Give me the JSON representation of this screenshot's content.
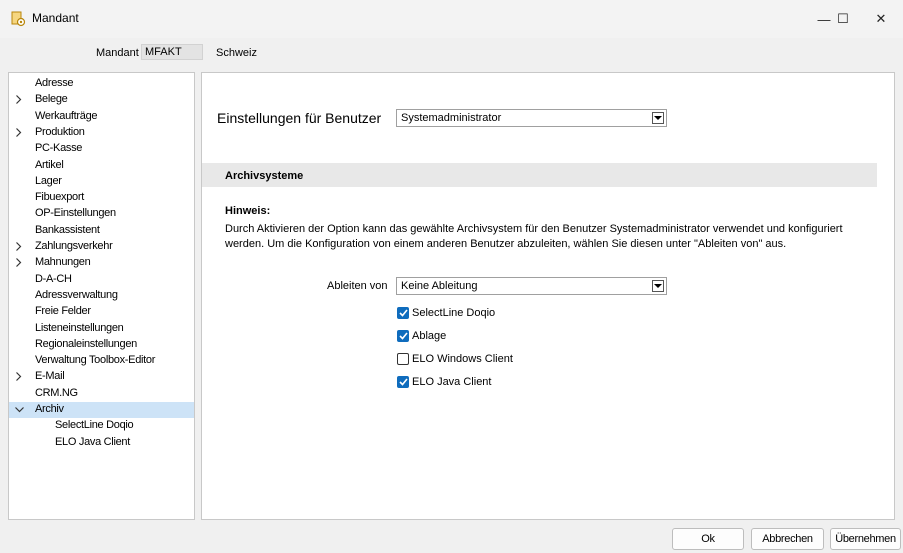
{
  "window": {
    "title": "Mandant",
    "icon": "gear-doc-icon",
    "controls": {
      "minimize": "—",
      "maximize": "☐",
      "close": "✕"
    }
  },
  "header": {
    "mandant_label": "Mandant",
    "mandant_code": "MFAKT",
    "mandant_name": "Schweiz"
  },
  "tree": {
    "items": [
      {
        "label": "Adresse",
        "expandable": false
      },
      {
        "label": "Belege",
        "expandable": true
      },
      {
        "label": "Werkaufträge",
        "expandable": false
      },
      {
        "label": "Produktion",
        "expandable": true
      },
      {
        "label": "PC-Kasse",
        "expandable": false
      },
      {
        "label": "Artikel",
        "expandable": false
      },
      {
        "label": "Lager",
        "expandable": false
      },
      {
        "label": "Fibuexport",
        "expandable": false
      },
      {
        "label": "OP-Einstellungen",
        "expandable": false
      },
      {
        "label": "Bankassistent",
        "expandable": false
      },
      {
        "label": "Zahlungsverkehr",
        "expandable": true
      },
      {
        "label": "Mahnungen",
        "expandable": true
      },
      {
        "label": "D-A-CH",
        "expandable": false
      },
      {
        "label": "Adressverwaltung",
        "expandable": false
      },
      {
        "label": "Freie Felder",
        "expandable": false
      },
      {
        "label": "Listeneinstellungen",
        "expandable": false
      },
      {
        "label": "Regionaleinstellungen",
        "expandable": false
      },
      {
        "label": "Verwaltung Toolbox-Editor",
        "expandable": false
      },
      {
        "label": "E-Mail",
        "expandable": true
      },
      {
        "label": "CRM.NG",
        "expandable": false
      },
      {
        "label": "Archiv",
        "expandable": true,
        "expanded": true,
        "selected": true
      },
      {
        "label": "SelectLine Doqio",
        "child": true
      },
      {
        "label": "ELO Java Client",
        "child": true
      }
    ]
  },
  "settings": {
    "user_label": "Einstellungen für Benutzer",
    "user_value": "Systemadministrator"
  },
  "section": {
    "title": "Archivsysteme",
    "hint_title": "Hinweis:",
    "hint_text": "Durch Aktivieren der Option kann das gewählte Archivsystem für den Benutzer Systemadministrator verwendet und konfiguriert werden. Um die Konfiguration von einem anderen Benutzer abzuleiten, wählen Sie diesen unter \"Ableiten von\" aus.",
    "derive_label": "Ableiten von",
    "derive_value": "Keine Ableitung",
    "options": [
      {
        "label": "SelectLine Doqio",
        "checked": true
      },
      {
        "label": "Ablage",
        "checked": true
      },
      {
        "label": "ELO Windows Client",
        "checked": false
      },
      {
        "label": "ELO Java Client",
        "checked": true
      }
    ]
  },
  "buttons": {
    "ok": "Ok",
    "cancel": "Abbrechen",
    "apply": "Übernehmen"
  },
  "colors": {
    "accent": "#0f6cbd",
    "selection": "#cde3f7",
    "section_bg": "#e8e8e8"
  }
}
